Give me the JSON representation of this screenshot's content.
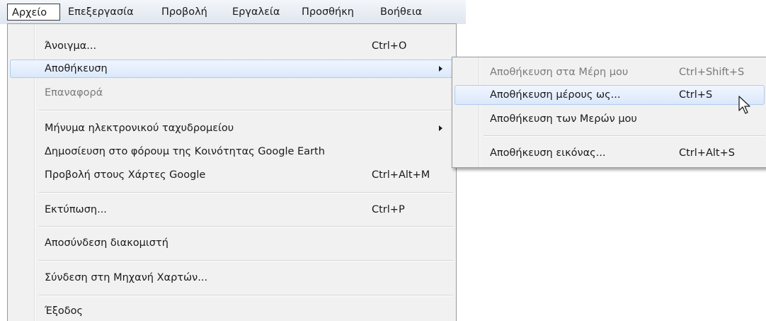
{
  "menubar": {
    "items": [
      {
        "label": "Αρχείο",
        "active": true
      },
      {
        "label": "Επεξεργασία"
      },
      {
        "label": "Προβολή"
      },
      {
        "label": "Εργαλεία"
      },
      {
        "label": "Προσθήκη"
      },
      {
        "label": "Βοήθεια"
      }
    ]
  },
  "file_menu": {
    "items": [
      {
        "label": "Άνοιγμα...",
        "shortcut": "Ctrl+O"
      },
      {
        "label": "Αποθήκευση",
        "submenu": true,
        "highlighted": true
      },
      {
        "label": "Επαναφορά",
        "disabled": true
      },
      {
        "label": "Μήνυμα ηλεκτρονικού ταχυδρομείου",
        "submenu": true
      },
      {
        "label": "Δημοσίευση στο φόρουμ της Κοινότητας Google Earth"
      },
      {
        "label": "Προβολή στους Χάρτες Google",
        "shortcut": "Ctrl+Alt+M"
      },
      {
        "label": "Εκτύπωση...",
        "shortcut": "Ctrl+P"
      },
      {
        "label": "Αποσύνδεση διακομιστή"
      },
      {
        "label": "Σύνδεση στη Μηχανή Χαρτών..."
      },
      {
        "label": "Έξοδος"
      }
    ]
  },
  "save_submenu": {
    "items": [
      {
        "label": "Αποθήκευση στα Μέρη μου",
        "shortcut": "Ctrl+Shift+S",
        "disabled": true
      },
      {
        "label": "Αποθήκευση μέρους ως...",
        "shortcut": "Ctrl+S",
        "highlighted": true
      },
      {
        "label": "Αποθήκευση των Μερών μου"
      },
      {
        "label": "Αποθήκευση εικόνας...",
        "shortcut": "Ctrl+Alt+S"
      }
    ]
  },
  "icons": {
    "submenu_arrow": "triangle-right-icon",
    "cursor": "mouse-pointer-icon"
  },
  "colors": {
    "menubar_top": "#f3f6fa",
    "menubar_bottom": "#dfe6ef",
    "menu_bg": "#f1f1f1",
    "highlight_border": "#aecbf0",
    "highlight_fill": "#dbe8fa",
    "disabled_text": "#7a7a7a"
  }
}
